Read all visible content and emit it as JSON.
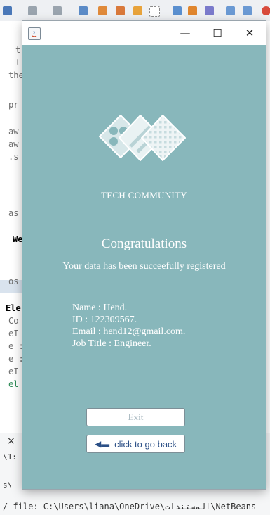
{
  "ide": {
    "code_lines": [
      "t",
      "t",
      "the",
      "pr",
      "aw",
      "aw",
      ".s",
      "as",
      "We",
      "os",
      "Ele",
      "Co",
      "eI",
      "e :",
      "e :",
      "eI",
      "el"
    ],
    "output_lines": [
      "\\1:",
      "s\\",
      "/ file: C:\\Users\\liana\\OneDrive\\المستندات\\NetBeans"
    ]
  },
  "window": {
    "minimize_label": "—",
    "maximize_label": "☐",
    "close_label": "✕"
  },
  "brand": {
    "name": "TECH COMMUNITY"
  },
  "message": {
    "title": "Congratulations",
    "subtitle": "Your data has been succeefully registered"
  },
  "details": {
    "name": "Name : Hend.",
    "id": "ID : 122309567.",
    "email": "Email : hend12@gmail.com.",
    "job": "Job Title : Engineer."
  },
  "buttons": {
    "exit": "Exit",
    "back": "click to go back"
  },
  "colors": {
    "panel": "#88b7bb",
    "button_text": "#2b4f86"
  }
}
